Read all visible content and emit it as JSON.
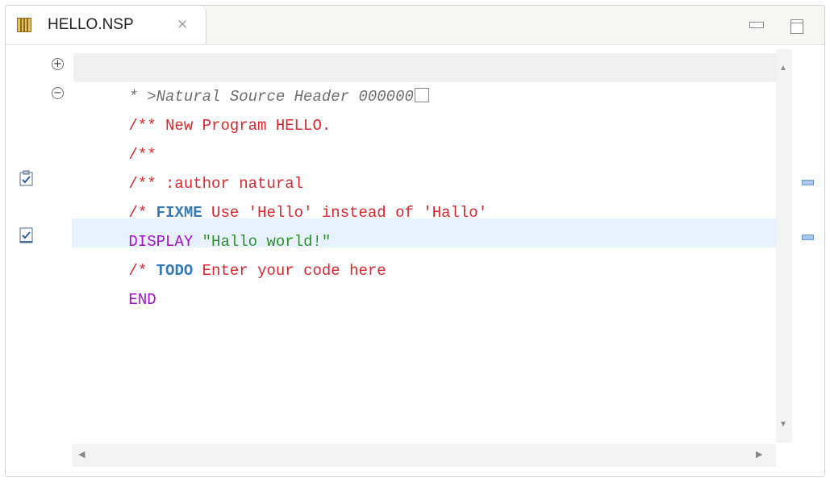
{
  "tab": {
    "title": "HELLO.NSP",
    "close_glyph": "⨯"
  },
  "window_controls": {
    "minimize": "minimize-icon",
    "maximize": "maximize-icon"
  },
  "code": {
    "line1_text": "* >Natural Source Header 000000",
    "line2_text": "/** New Program HELLO.",
    "line3_text": "/**",
    "line4_text": "/** :author natural",
    "line5_prefix": "/* ",
    "line5_keyword": "FIXME",
    "line5_rest": " Use 'Hello' instead of 'Hallo'",
    "line6_keyword": "DISPLAY",
    "line6_string": " \"Hallo world!\"",
    "line7_prefix": "/* ",
    "line7_keyword": "TODO",
    "line7_rest": " Enter your code here",
    "line8_keyword": "END"
  },
  "colors": {
    "comment_header": "#6e6e6e",
    "comment": "#d9262d",
    "task_tag": "#3478b4",
    "keyword": "#a013c8",
    "string": "#2f8f2f",
    "current_line": "#e8f2fe"
  }
}
